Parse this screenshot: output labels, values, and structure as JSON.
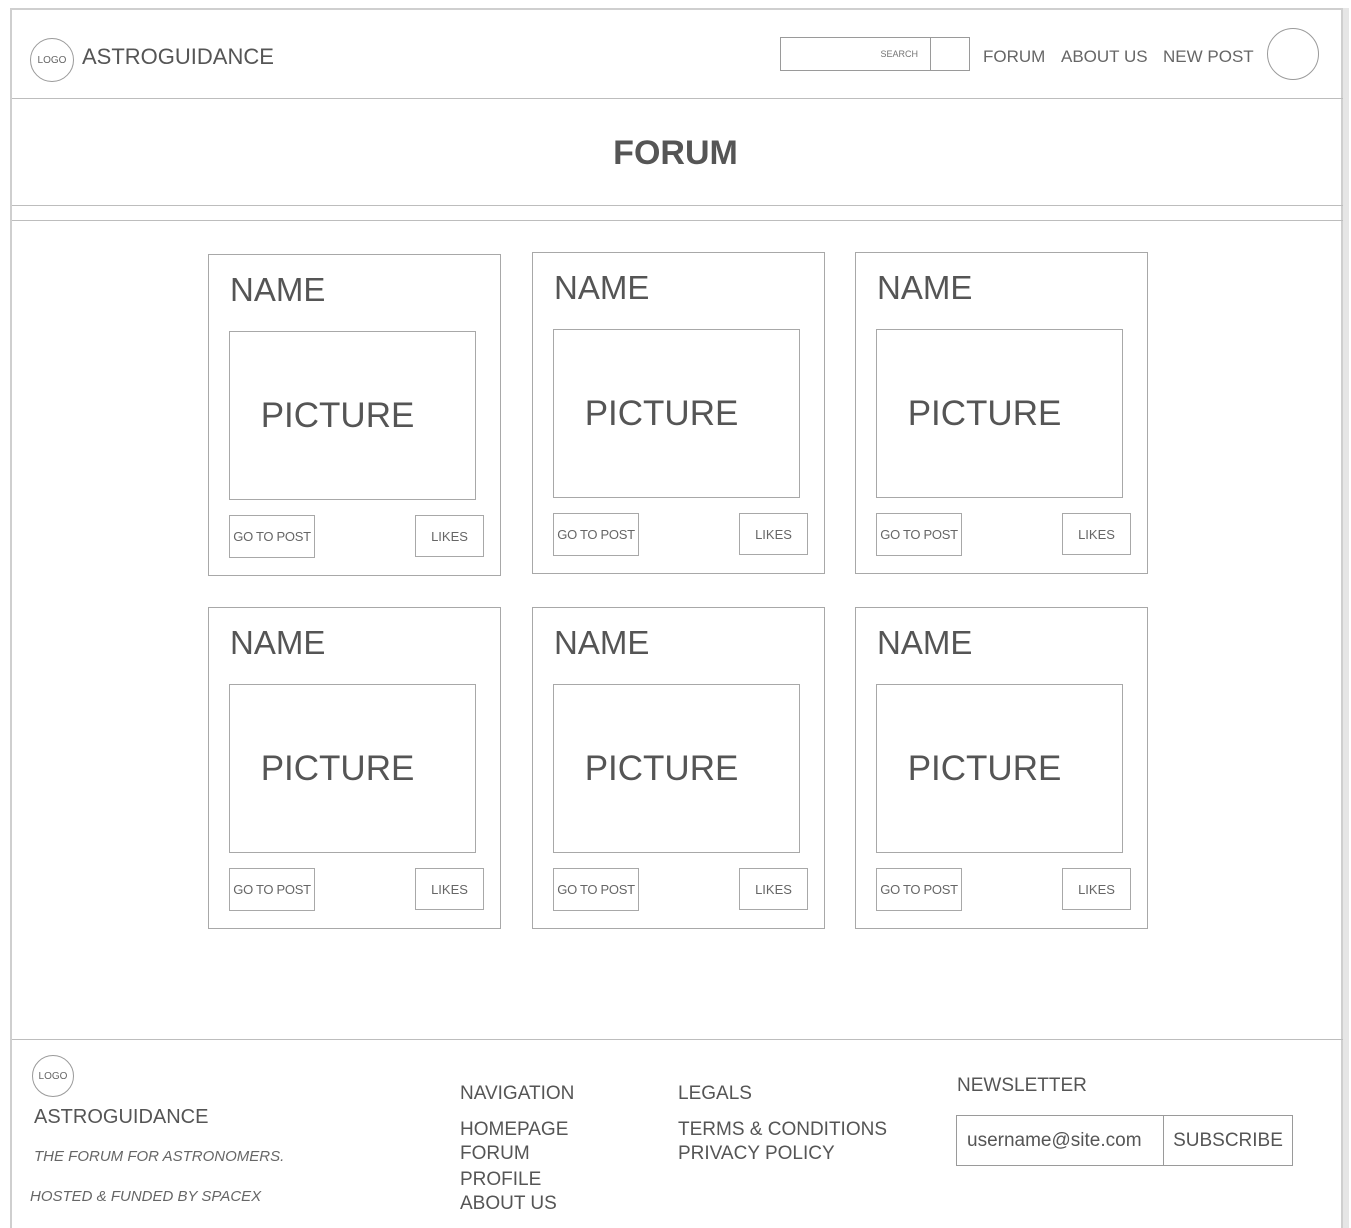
{
  "header": {
    "logo": "LOGO",
    "brand": "ASTROGUIDANCE",
    "search_placeholder": "SEARCH",
    "nav": [
      "FORUM",
      "ABOUT US",
      "NEW POST"
    ]
  },
  "page": {
    "title": "FORUM"
  },
  "cards": [
    {
      "name": "NAME",
      "picture": "PICTURE",
      "go_label": "GO TO POST",
      "likes_label": "LIKES"
    },
    {
      "name": "NAME",
      "picture": "PICTURE",
      "go_label": "GO TO POST",
      "likes_label": "LIKES"
    },
    {
      "name": "NAME",
      "picture": "PICTURE",
      "go_label": "GO TO POST",
      "likes_label": "LIKES"
    },
    {
      "name": "NAME",
      "picture": "PICTURE",
      "go_label": "GO TO POST",
      "likes_label": "LIKES"
    },
    {
      "name": "NAME",
      "picture": "PICTURE",
      "go_label": "GO TO POST",
      "likes_label": "LIKES"
    },
    {
      "name": "NAME",
      "picture": "PICTURE",
      "go_label": "GO TO POST",
      "likes_label": "LIKES"
    }
  ],
  "footer": {
    "logo": "LOGO",
    "brand": "ASTROGUIDANCE",
    "tagline": "THE FORUM FOR ASTRONOMERS.",
    "hosted": "HOSTED & FUNDED BY SPACEX",
    "navigation": {
      "heading": "NAVIGATION",
      "links": [
        "HOMEPAGE",
        "FORUM",
        "PROFILE",
        "ABOUT US"
      ]
    },
    "legals": {
      "heading": "LEGALS",
      "links": [
        "TERMS & CONDITIONS",
        "PRIVACY POLICY"
      ]
    },
    "newsletter": {
      "heading": "NEWSLETTER",
      "input_value": "username@site.com",
      "button": "SUBSCRIBE"
    }
  }
}
